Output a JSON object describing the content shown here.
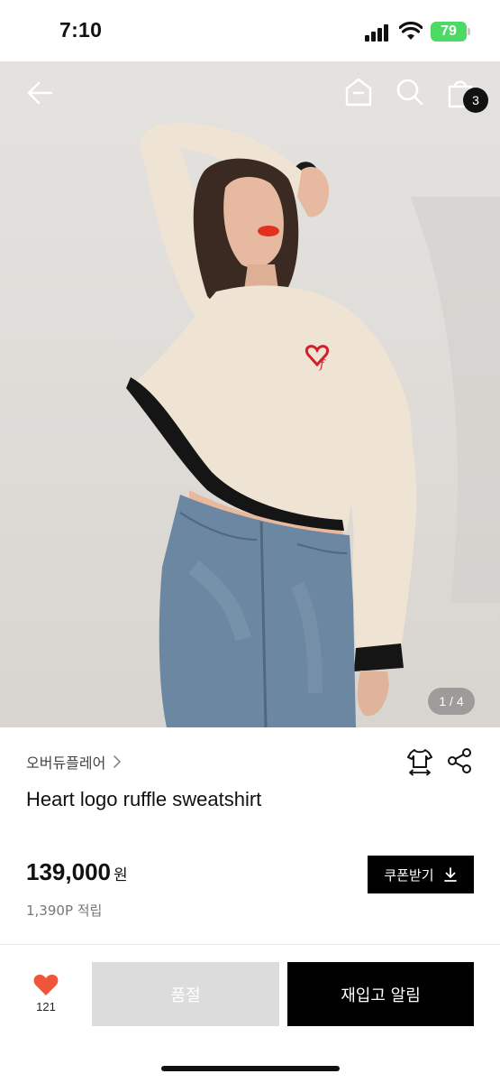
{
  "status_bar": {
    "time": "7:10",
    "battery": "79",
    "icons": [
      "signal-icon",
      "wifi-icon",
      "battery-icon"
    ]
  },
  "nav": {
    "icons": [
      "back-arrow-icon",
      "home-icon",
      "search-icon",
      "shopping-bag-icon"
    ],
    "cart_count": "3"
  },
  "gallery": {
    "indicator": "1 / 4"
  },
  "product": {
    "brand": "오버듀플레어",
    "title": "Heart logo ruffle sweatshirt",
    "price": "139,000",
    "currency": "원",
    "points": "1,390P 적립",
    "coupon_label": "쿠폰받기",
    "icons": [
      "size-guide-icon",
      "share-icon",
      "download-icon"
    ]
  },
  "bottom_bar": {
    "like_count": "121",
    "soldout_label": "품절",
    "restock_label": "재입고 알림",
    "heart_color": "#f0553a"
  }
}
